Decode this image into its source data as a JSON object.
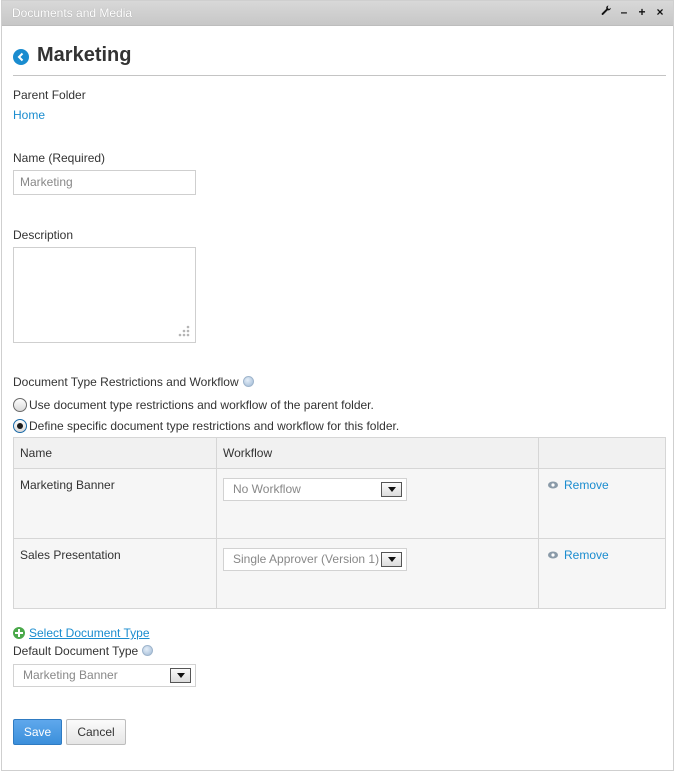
{
  "window": {
    "title": "Documents and Media",
    "controls": [
      "wrench-icon",
      "minimize-icon",
      "maximize-icon",
      "close-icon"
    ]
  },
  "page": {
    "title": "Marketing"
  },
  "parent_folder": {
    "label": "Parent Folder",
    "link": "Home"
  },
  "name_field": {
    "label": "Name (Required)",
    "value": "Marketing"
  },
  "description_field": {
    "label": "Description",
    "value": ""
  },
  "restrictions": {
    "label": "Document Type Restrictions and Workflow",
    "options": [
      {
        "label": "Use document type restrictions and workflow of the parent folder.",
        "checked": false
      },
      {
        "label": "Define specific document type restrictions and workflow for this folder.",
        "checked": true
      }
    ]
  },
  "table": {
    "headers": [
      "Name",
      "Workflow",
      ""
    ],
    "rows": [
      {
        "name": "Marketing Banner",
        "workflow": "No Workflow",
        "action": "Remove"
      },
      {
        "name": "Sales Presentation",
        "workflow": "Single Approver (Version 1)",
        "action": "Remove"
      }
    ]
  },
  "select_document_type": "Select Document Type",
  "default_document_type": {
    "label": "Default Document Type",
    "value": "Marketing Banner"
  },
  "buttons": {
    "save": "Save",
    "cancel": "Cancel"
  },
  "colors": {
    "accent": "#1a8ccf",
    "primary_button": "#3b8fdb",
    "titlebar": "#cccccc"
  }
}
